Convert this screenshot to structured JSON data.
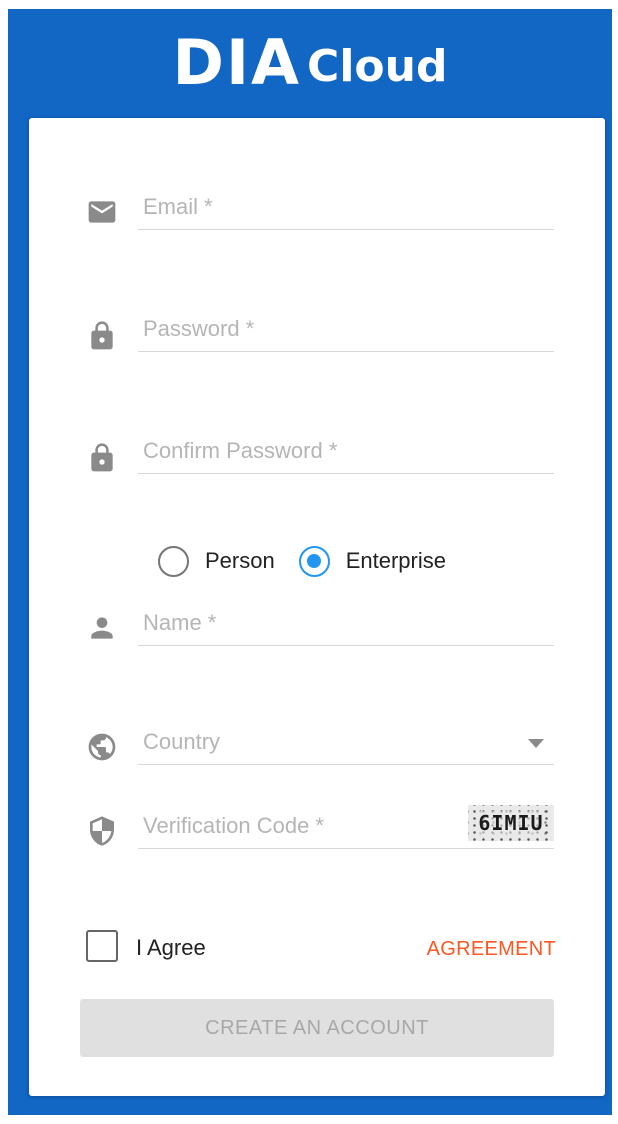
{
  "logo": {
    "big": "DIA",
    "small": "Cloud"
  },
  "form": {
    "email": {
      "placeholder": "Email *",
      "icon": "email-icon"
    },
    "password": {
      "placeholder": "Password *",
      "icon": "lock-icon"
    },
    "confirm_password": {
      "placeholder": "Confirm Password *",
      "icon": "lock-icon"
    },
    "account_type": {
      "options": [
        "Person",
        "Enterprise"
      ],
      "selected": "Enterprise"
    },
    "name": {
      "placeholder": "Name *",
      "icon": "person-icon"
    },
    "country": {
      "placeholder": "Country",
      "icon": "globe-icon"
    },
    "verification": {
      "placeholder": "Verification Code *",
      "icon": "shield-icon",
      "captcha_text": "6IMIU"
    },
    "agree": {
      "label": "I Agree",
      "checked": false
    },
    "agreement_link": "AGREEMENT",
    "submit_label": "CREATE AN ACCOUNT"
  },
  "colors": {
    "brand_blue": "#1266c4",
    "radio_selected": "#2196f3",
    "link": "#ff5722",
    "icon_grey": "#8a8a8a"
  }
}
